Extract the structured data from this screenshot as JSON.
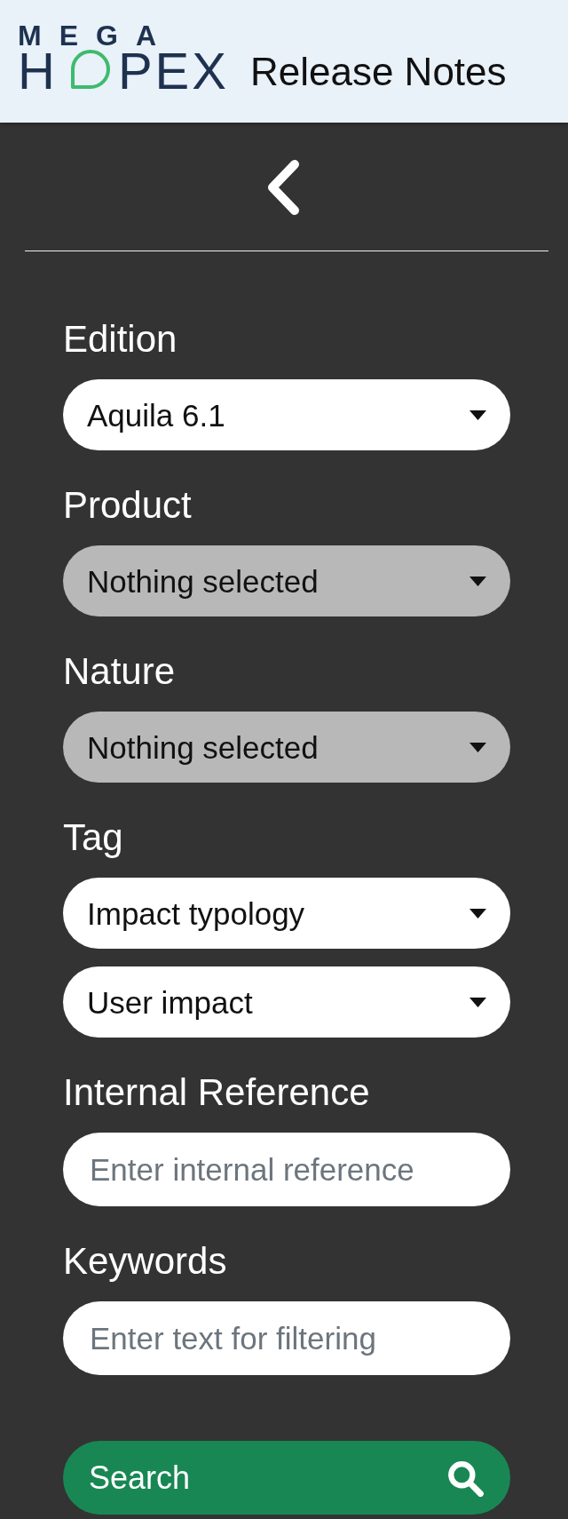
{
  "header": {
    "logo": {
      "line_1": "MEGA",
      "line_2": [
        "H",
        "PEX"
      ]
    },
    "title": "Release Notes"
  },
  "sidebar": {
    "filters": [
      {
        "label": "Edition",
        "controls": [
          {
            "kind": "select",
            "value": "Aquila 6.1",
            "disabled": false
          }
        ]
      },
      {
        "label": "Product",
        "controls": [
          {
            "kind": "select",
            "value": "Nothing selected",
            "disabled": true
          }
        ]
      },
      {
        "label": "Nature",
        "controls": [
          {
            "kind": "select",
            "value": "Nothing selected",
            "disabled": true
          }
        ]
      },
      {
        "label": "Tag",
        "controls": [
          {
            "kind": "select",
            "value": "Impact typology",
            "disabled": false
          },
          {
            "kind": "select",
            "value": "User impact",
            "disabled": false
          }
        ]
      },
      {
        "label": "Internal Reference",
        "controls": [
          {
            "kind": "input",
            "placeholder": "Enter internal reference"
          }
        ]
      },
      {
        "label": "Keywords",
        "controls": [
          {
            "kind": "input",
            "placeholder": "Enter text for filtering"
          }
        ]
      }
    ],
    "search_button": {
      "label": "Search"
    }
  }
}
